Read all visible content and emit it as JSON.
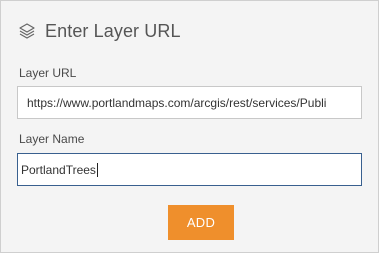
{
  "header": {
    "icon": "layers-icon",
    "title": "Enter Layer URL"
  },
  "form": {
    "url_label": "Layer URL",
    "url_value": "https://www.portlandmaps.com/arcgis/rest/services/Publi",
    "name_label": "Layer Name",
    "name_value": "PortlandTrees",
    "add_label": "ADD"
  },
  "colors": {
    "panel_bg": "#f4f4f4",
    "accent_button": "#ef8f2c",
    "focus_border": "#39608f",
    "title_text": "#555555"
  }
}
